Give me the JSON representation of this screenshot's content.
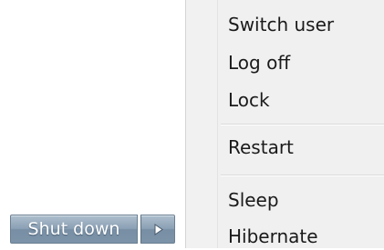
{
  "menu": {
    "items": [
      {
        "label": "Switch user"
      },
      {
        "label": "Log off"
      },
      {
        "label": "Lock"
      },
      {
        "label": "Restart"
      },
      {
        "label": "Sleep"
      },
      {
        "label": "Hibernate"
      }
    ]
  },
  "shutdown": {
    "label": "Shut down",
    "arrow_icon": "chevron-right-icon"
  },
  "colors": {
    "menu_background": "#f0f0f0",
    "button_blue": "#8ba0b4",
    "text": "#1a1a1a"
  }
}
